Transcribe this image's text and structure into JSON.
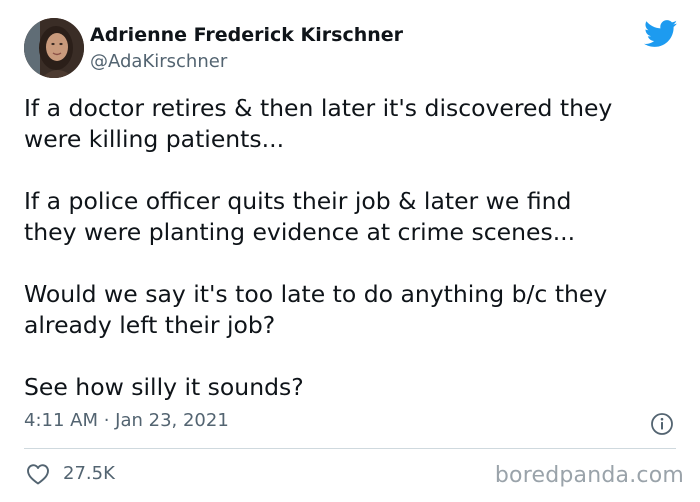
{
  "author": {
    "name": "Adrienne Frederick Kirschner",
    "handle": "@AdaKirschner",
    "avatar_icon": "profile-photo"
  },
  "tweet": {
    "paragraphs": [
      "If a doctor retires & then later it's discovered they\nwere killing patients...",
      "If a police officer quits their job & later we find\nthey were planting evidence at crime scenes...",
      "Would we say it's too late to do anything b/c they\nalready left their job?",
      "See how silly it sounds?"
    ],
    "timestamp": "4:11 AM · Jan 23, 2021",
    "likes": "27.5K"
  },
  "icons": {
    "brand": "twitter-bird-icon",
    "info": "info-icon",
    "like": "heart-icon"
  },
  "colors": {
    "brand_blue": "#1d9bf0",
    "secondary_text": "#536471",
    "primary_text": "#0f1419"
  },
  "watermark": "boredpanda.com"
}
